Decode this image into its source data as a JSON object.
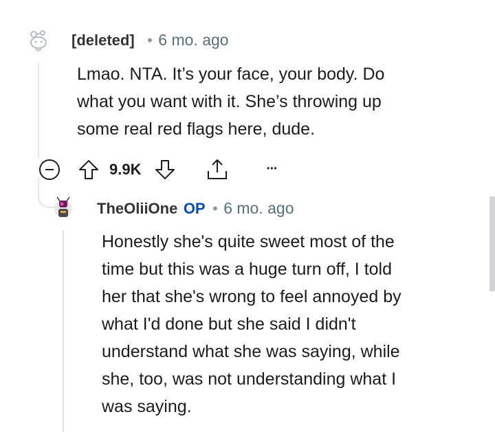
{
  "comments": [
    {
      "username": "[deleted]",
      "separator": "•",
      "age": "6 mo. ago",
      "body_lines": [
        "Lmao. NTA. It’s your face, your body. Do",
        "what you want with it. She’s throwing up",
        "some real red flags here, dude."
      ],
      "votes": "9.9K"
    },
    {
      "username": "TheOliiOne",
      "op_badge": "OP",
      "separator": "•",
      "age": "6 mo. ago",
      "body_lines": [
        "Honestly she's quite sweet most of the",
        "time but this was a huge turn off, I told",
        "her that she's wrong to feel annoyed by",
        "what I'd done but she said I didn't",
        "understand what she was saying, while",
        "she, too, was not understanding what I",
        "was saying."
      ]
    }
  ],
  "actions": {
    "more_glyph": "•••"
  },
  "colors": {
    "accent_op": "#0a4bb3",
    "meta": "#576f76",
    "thread_line": "#e4e6e8"
  }
}
